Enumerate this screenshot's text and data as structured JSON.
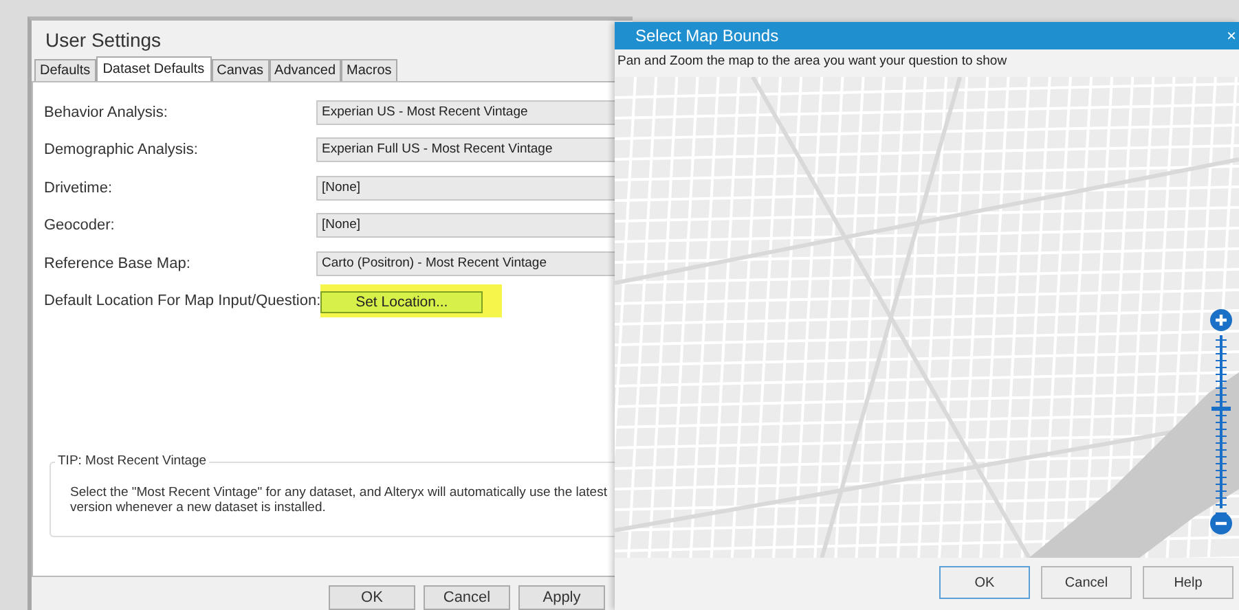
{
  "settings": {
    "title": "User Settings",
    "tabs": [
      {
        "label": "Defaults",
        "selected": false
      },
      {
        "label": "Dataset Defaults",
        "selected": true
      },
      {
        "label": "Canvas",
        "selected": false
      },
      {
        "label": "Advanced",
        "selected": false
      },
      {
        "label": "Macros",
        "selected": false
      }
    ],
    "fields": [
      {
        "label": "Behavior Analysis:",
        "value": "Experian US - Most Recent Vintage"
      },
      {
        "label": "Demographic Analysis:",
        "value": "Experian Full US - Most Recent Vintage"
      },
      {
        "label": "Drivetime:",
        "value": "[None]"
      },
      {
        "label": "Geocoder:",
        "value": "[None]"
      },
      {
        "label": "Reference Base Map:",
        "value": "Carto (Positron) - Most Recent Vintage"
      }
    ],
    "location": {
      "label": "Default Location For Map Input/Question:",
      "button": "Set Location...",
      "highlighted": true
    },
    "tip": {
      "title": "TIP: Most Recent Vintage",
      "text": "Select the \"Most Recent Vintage\" for any dataset, and Alteryx will automatically use the latest version whenever a new dataset is installed."
    },
    "buttons": [
      "OK",
      "Cancel",
      "Apply"
    ]
  },
  "map_dialog": {
    "title": "Select Map Bounds",
    "close": "×",
    "instruction": "Pan and Zoom the map to the area you want your question to show",
    "zoom": {
      "level": 0.57
    },
    "buttons": [
      {
        "label": "OK",
        "default": true
      },
      {
        "label": "Cancel",
        "default": false
      },
      {
        "label": "Help",
        "default": false
      }
    ]
  }
}
